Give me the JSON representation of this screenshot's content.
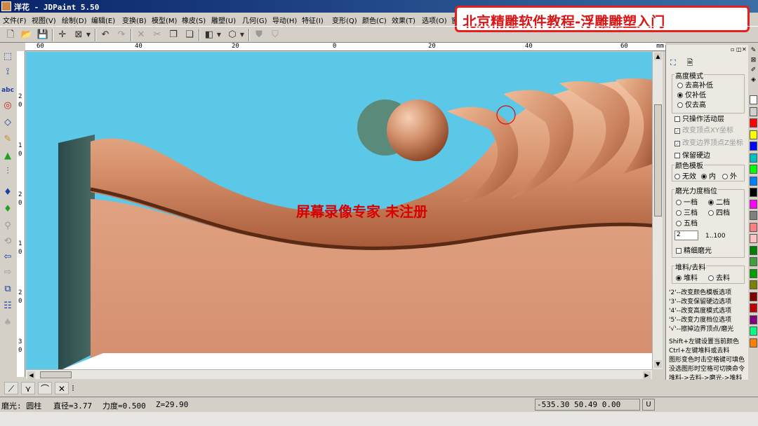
{
  "window": {
    "title": "洋花 - JDPaint 5.50"
  },
  "banner": {
    "text": "北京精雕软件教程-浮雕雕塑入门"
  },
  "menu": [
    "文件(F)",
    "视图(V)",
    "绘制(D)",
    "编辑(E)",
    "变换(B)",
    "模型(M)",
    "橡皮(S)",
    "雕塑(U)",
    "几何(G)",
    "导动(H)",
    "特征(I)",
    "变形(Q)",
    "颜色(C)",
    "效果(T)",
    "选项(O)",
    "窗口"
  ],
  "toolbar": {
    "icons": [
      "new-file-icon",
      "open-folder-icon",
      "save-icon",
      "crosshair-icon",
      "box-select-icon",
      "dropdown-arrow-icon",
      "undo-icon",
      "redo-icon",
      "cut-x-icon",
      "scissors-icon",
      "copy-icon",
      "paste-icon",
      "cube-icon",
      "rotate-view-icon",
      "shape-a-icon",
      "shape-b-icon"
    ]
  },
  "ruler": {
    "h_ticks": [
      "60",
      "40",
      "20",
      "0",
      "20",
      "40",
      "60"
    ],
    "unit": "mm",
    "v_ticks": [
      "2",
      "0",
      "1",
      "0",
      "2",
      "0",
      "1",
      "0",
      "2",
      "0",
      "3",
      "0"
    ]
  },
  "viewport": {
    "watermark": "屏幕录像专家  未注册",
    "colors": {
      "background": "#5ac8e6",
      "relief": "#d89a78",
      "relief_dark": "#7a3e22"
    }
  },
  "panel": {
    "height_mode": {
      "title": "高度模式",
      "options": [
        "去高补低",
        "仅补低",
        "仅去高"
      ],
      "selected": 1
    },
    "checks": [
      {
        "label": "只操作活动层",
        "checked": false,
        "disabled": false
      },
      {
        "label": "改变顶点XY坐标",
        "checked": true,
        "disabled": true
      },
      {
        "label": "改变边界顶点Z坐标",
        "checked": true,
        "disabled": true
      },
      {
        "label": "保留硬边",
        "checked": false,
        "disabled": false
      }
    ],
    "color_template": {
      "title": "颜色模板",
      "options": [
        "无效",
        "内",
        "外"
      ],
      "selected": 1
    },
    "grind_level": {
      "title": "磨光力度档位",
      "options": [
        "一档",
        "二档",
        "三档",
        "四档",
        "五档"
      ],
      "selected": 1,
      "value": "2",
      "range": "1..100",
      "fine_label": "精细磨光"
    },
    "material": {
      "title": "堆料/去料",
      "options": [
        "堆料",
        "去料"
      ],
      "selected": 0
    },
    "help": [
      "'2'--改变颜色模板选项",
      "'3'--改变保留硬边选项",
      "'4'--改变高度模式选项",
      "'5'--改变力度档位选项",
      "'√'--擦掉边界顶点/磨光",
      "",
      "Shift+左键设置当前颜色",
      "Ctrl+左键堆料或去料",
      "图形变色时击空格键可填色",
      "没选图形时空格可切换命令",
      "堆料->去料->磨光->堆料"
    ]
  },
  "palette": [
    "#ffffff",
    "#d0d0d0",
    "#ff0000",
    "#ffff00",
    "#0000ff",
    "#00c0c0",
    "#00ff00",
    "#0080ff",
    "#000000",
    "#ff00ff",
    "#808080",
    "#ff8080",
    "#ffc0c0",
    "#008000",
    "#40a040",
    "#00a000",
    "#808000",
    "#800000",
    "#c00000",
    "#800080",
    "#00ff80",
    "#ff8000"
  ],
  "status": {
    "mode": "磨光: 圆柱",
    "diameter": "直径=3.77",
    "force": "力度=0.500",
    "z": "Z=29.90",
    "coords": "-535.30 50.49 0.00",
    "unit_btn": "U"
  }
}
